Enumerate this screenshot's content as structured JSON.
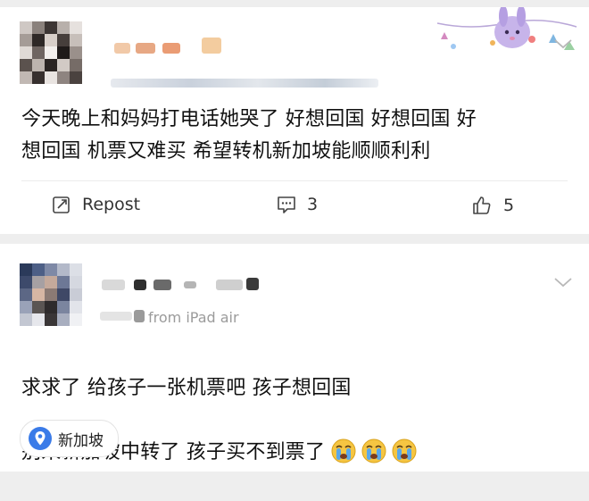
{
  "post": {
    "text": "今天晚上和妈妈打电话她哭了 好想回国 好想回国 好\n想回国 机票又难买 希望转机新加坡能顺顺利利",
    "actions": {
      "repost_label": "Repost",
      "comment_count": "3",
      "like_count": "5"
    },
    "icons": [
      "repost-icon",
      "comment-icon",
      "like-icon",
      "chevron-down-icon"
    ]
  },
  "comment": {
    "source_text": "from iPad air",
    "text_line1": "求求了 给孩子一张机票吧 孩子想回国",
    "text_line2": "别来新加坡中转了 孩子买不到票了",
    "emojis": [
      "crying-emoji",
      "crying-emoji",
      "crying-emoji"
    ],
    "location_label": "新加坡",
    "icons": [
      "location-pin-icon",
      "chevron-down-icon"
    ]
  },
  "colors": {
    "background": "#eeeeee",
    "card": "#ffffff",
    "pin_blue": "#3a7be8",
    "text": "#111111",
    "muted": "#9b9b9b"
  }
}
